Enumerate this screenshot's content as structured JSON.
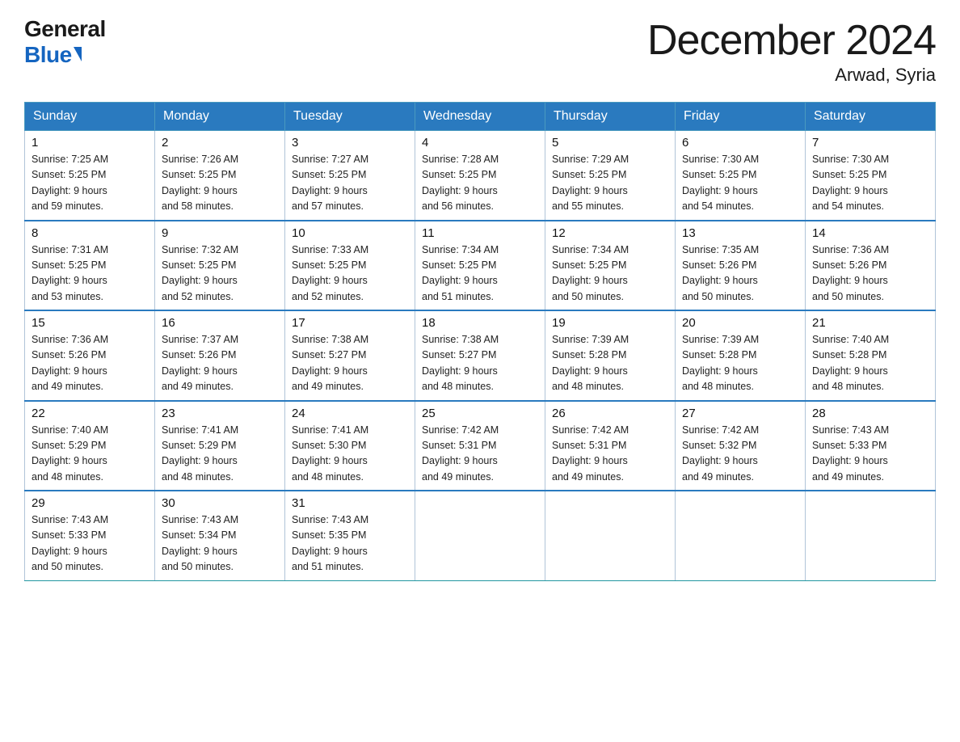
{
  "logo": {
    "general": "General",
    "blue": "Blue"
  },
  "title": "December 2024",
  "location": "Arwad, Syria",
  "days_of_week": [
    "Sunday",
    "Monday",
    "Tuesday",
    "Wednesday",
    "Thursday",
    "Friday",
    "Saturday"
  ],
  "weeks": [
    [
      {
        "day": "1",
        "sunrise": "7:25 AM",
        "sunset": "5:25 PM",
        "daylight": "9 hours and 59 minutes."
      },
      {
        "day": "2",
        "sunrise": "7:26 AM",
        "sunset": "5:25 PM",
        "daylight": "9 hours and 58 minutes."
      },
      {
        "day": "3",
        "sunrise": "7:27 AM",
        "sunset": "5:25 PM",
        "daylight": "9 hours and 57 minutes."
      },
      {
        "day": "4",
        "sunrise": "7:28 AM",
        "sunset": "5:25 PM",
        "daylight": "9 hours and 56 minutes."
      },
      {
        "day": "5",
        "sunrise": "7:29 AM",
        "sunset": "5:25 PM",
        "daylight": "9 hours and 55 minutes."
      },
      {
        "day": "6",
        "sunrise": "7:30 AM",
        "sunset": "5:25 PM",
        "daylight": "9 hours and 54 minutes."
      },
      {
        "day": "7",
        "sunrise": "7:30 AM",
        "sunset": "5:25 PM",
        "daylight": "9 hours and 54 minutes."
      }
    ],
    [
      {
        "day": "8",
        "sunrise": "7:31 AM",
        "sunset": "5:25 PM",
        "daylight": "9 hours and 53 minutes."
      },
      {
        "day": "9",
        "sunrise": "7:32 AM",
        "sunset": "5:25 PM",
        "daylight": "9 hours and 52 minutes."
      },
      {
        "day": "10",
        "sunrise": "7:33 AM",
        "sunset": "5:25 PM",
        "daylight": "9 hours and 52 minutes."
      },
      {
        "day": "11",
        "sunrise": "7:34 AM",
        "sunset": "5:25 PM",
        "daylight": "9 hours and 51 minutes."
      },
      {
        "day": "12",
        "sunrise": "7:34 AM",
        "sunset": "5:25 PM",
        "daylight": "9 hours and 50 minutes."
      },
      {
        "day": "13",
        "sunrise": "7:35 AM",
        "sunset": "5:26 PM",
        "daylight": "9 hours and 50 minutes."
      },
      {
        "day": "14",
        "sunrise": "7:36 AM",
        "sunset": "5:26 PM",
        "daylight": "9 hours and 50 minutes."
      }
    ],
    [
      {
        "day": "15",
        "sunrise": "7:36 AM",
        "sunset": "5:26 PM",
        "daylight": "9 hours and 49 minutes."
      },
      {
        "day": "16",
        "sunrise": "7:37 AM",
        "sunset": "5:26 PM",
        "daylight": "9 hours and 49 minutes."
      },
      {
        "day": "17",
        "sunrise": "7:38 AM",
        "sunset": "5:27 PM",
        "daylight": "9 hours and 49 minutes."
      },
      {
        "day": "18",
        "sunrise": "7:38 AM",
        "sunset": "5:27 PM",
        "daylight": "9 hours and 48 minutes."
      },
      {
        "day": "19",
        "sunrise": "7:39 AM",
        "sunset": "5:28 PM",
        "daylight": "9 hours and 48 minutes."
      },
      {
        "day": "20",
        "sunrise": "7:39 AM",
        "sunset": "5:28 PM",
        "daylight": "9 hours and 48 minutes."
      },
      {
        "day": "21",
        "sunrise": "7:40 AM",
        "sunset": "5:28 PM",
        "daylight": "9 hours and 48 minutes."
      }
    ],
    [
      {
        "day": "22",
        "sunrise": "7:40 AM",
        "sunset": "5:29 PM",
        "daylight": "9 hours and 48 minutes."
      },
      {
        "day": "23",
        "sunrise": "7:41 AM",
        "sunset": "5:29 PM",
        "daylight": "9 hours and 48 minutes."
      },
      {
        "day": "24",
        "sunrise": "7:41 AM",
        "sunset": "5:30 PM",
        "daylight": "9 hours and 48 minutes."
      },
      {
        "day": "25",
        "sunrise": "7:42 AM",
        "sunset": "5:31 PM",
        "daylight": "9 hours and 49 minutes."
      },
      {
        "day": "26",
        "sunrise": "7:42 AM",
        "sunset": "5:31 PM",
        "daylight": "9 hours and 49 minutes."
      },
      {
        "day": "27",
        "sunrise": "7:42 AM",
        "sunset": "5:32 PM",
        "daylight": "9 hours and 49 minutes."
      },
      {
        "day": "28",
        "sunrise": "7:43 AM",
        "sunset": "5:33 PM",
        "daylight": "9 hours and 49 minutes."
      }
    ],
    [
      {
        "day": "29",
        "sunrise": "7:43 AM",
        "sunset": "5:33 PM",
        "daylight": "9 hours and 50 minutes."
      },
      {
        "day": "30",
        "sunrise": "7:43 AM",
        "sunset": "5:34 PM",
        "daylight": "9 hours and 50 minutes."
      },
      {
        "day": "31",
        "sunrise": "7:43 AM",
        "sunset": "5:35 PM",
        "daylight": "9 hours and 51 minutes."
      },
      null,
      null,
      null,
      null
    ]
  ],
  "labels": {
    "sunrise": "Sunrise:",
    "sunset": "Sunset:",
    "daylight": "Daylight:"
  }
}
